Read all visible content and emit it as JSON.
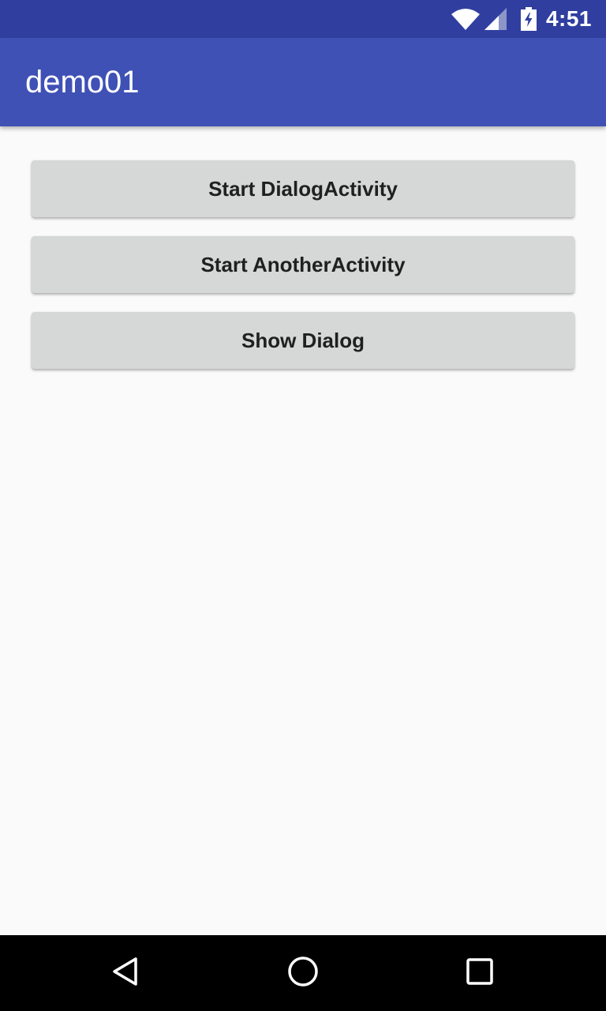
{
  "status_bar": {
    "time": "4:51",
    "icons": [
      "wifi-icon",
      "signal-icon",
      "battery-charging-icon"
    ],
    "background_color": "#303f9f"
  },
  "app_bar": {
    "title": "demo01",
    "background_color": "#3f51b5"
  },
  "buttons": [
    {
      "label": "Start DialogActivity"
    },
    {
      "label": "Start AnotherActivity"
    },
    {
      "label": "Show Dialog"
    }
  ],
  "nav_bar": {
    "items": [
      "back-icon",
      "home-icon",
      "recents-icon"
    ]
  }
}
